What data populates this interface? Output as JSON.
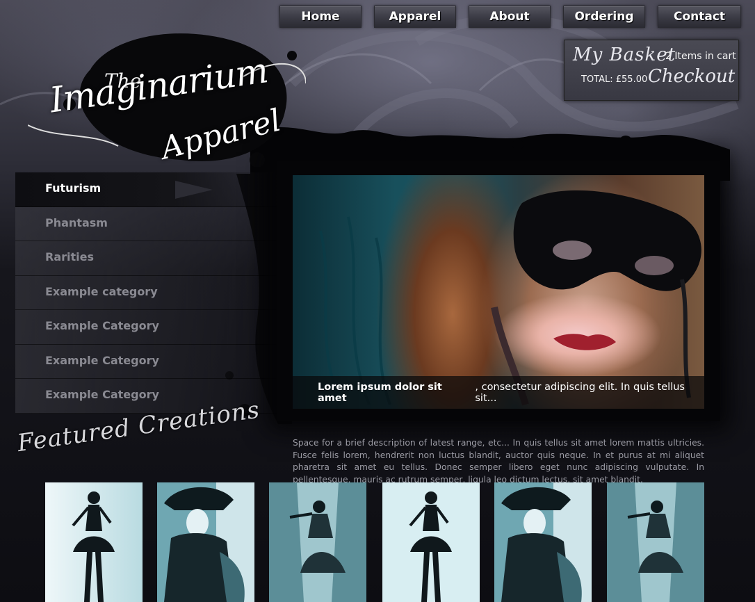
{
  "nav": {
    "items": [
      "Home",
      "Apparel",
      "About",
      "Ordering",
      "Contact"
    ]
  },
  "basket": {
    "title": "My Basket",
    "items_text": "2 Items in cart",
    "total_text": "TOTAL: £55.00",
    "checkout_label": "Checkout"
  },
  "logo": {
    "the": "The",
    "name_line1": "Imaginarium",
    "name_line2": "Apparel"
  },
  "sidebar": {
    "items": [
      {
        "label": "Futurism",
        "active": true
      },
      {
        "label": "Phantasm"
      },
      {
        "label": "Rarities"
      },
      {
        "label": "Example category"
      },
      {
        "label": "Example Category"
      },
      {
        "label": "Example Category"
      },
      {
        "label": "Example Category"
      }
    ]
  },
  "hero": {
    "caption_bold": "Lorem ipsum dolor sit amet",
    "caption_rest": ", consectetur adipiscing elit. In quis tellus sit..."
  },
  "description": "Space for a brief description of latest range, etc... In quis tellus sit amet lorem mattis ultricies. Fusce felis lorem, hendrerit non luctus blandit, auctor quis neque. In et purus at mi aliquet pharetra sit amet eu tellus. Donec semper libero eget nunc adipiscing vulputate. In pellentesque, mauris ac rutrum semper, ligula leo dictum lectus, sit amet blandit.",
  "featured": {
    "heading": "Featured Creations",
    "thumbnails": [
      "corset-dress-figure",
      "masked-cavalier-figure",
      "corridor-dress-figure",
      "corset-dress-figure",
      "masked-cavalier-figure",
      "corridor-dress-figure"
    ]
  },
  "colors": {
    "background": "#121217",
    "nav_button": "#3a3a44",
    "sidebar_active_text": "#ffffff",
    "sidebar_text": "#8a8a92",
    "description_text": "#9b9ba4",
    "thumb_tint": "#9fcbd3"
  }
}
